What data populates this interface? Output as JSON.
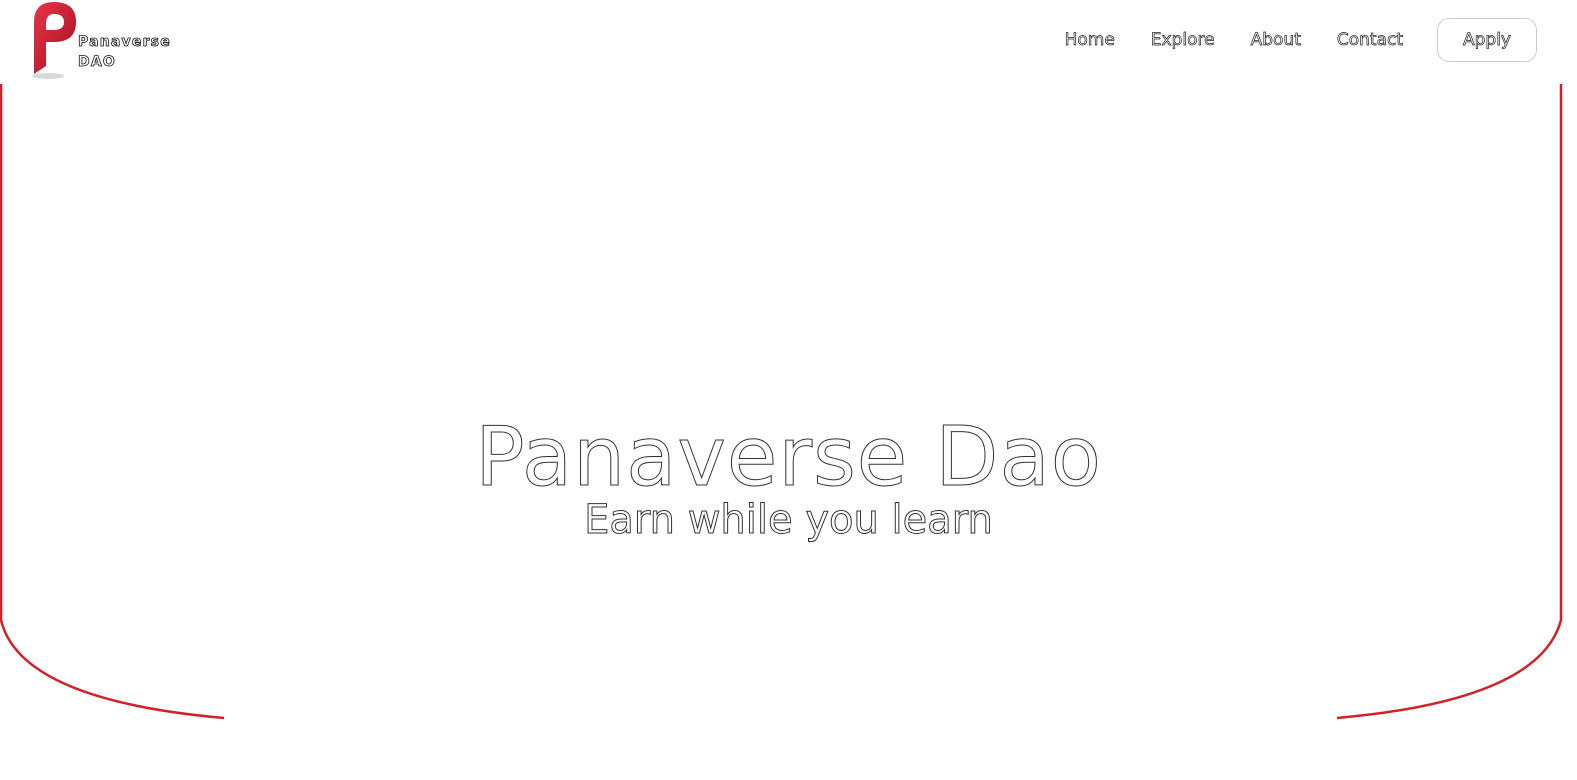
{
  "brand": {
    "name_line1": "Panaverse",
    "name_line2": "DAO",
    "logo_icon": "panaverse-p-logo-icon",
    "accent_color": "#d0202a"
  },
  "nav": {
    "links": [
      {
        "label": "Home"
      },
      {
        "label": "Explore"
      },
      {
        "label": "About"
      },
      {
        "label": "Contact"
      }
    ],
    "apply_label": "Apply"
  },
  "hero": {
    "title": "Panaverse Dao",
    "subtitle": "Earn while you learn",
    "frame_color": "#d0202a"
  }
}
